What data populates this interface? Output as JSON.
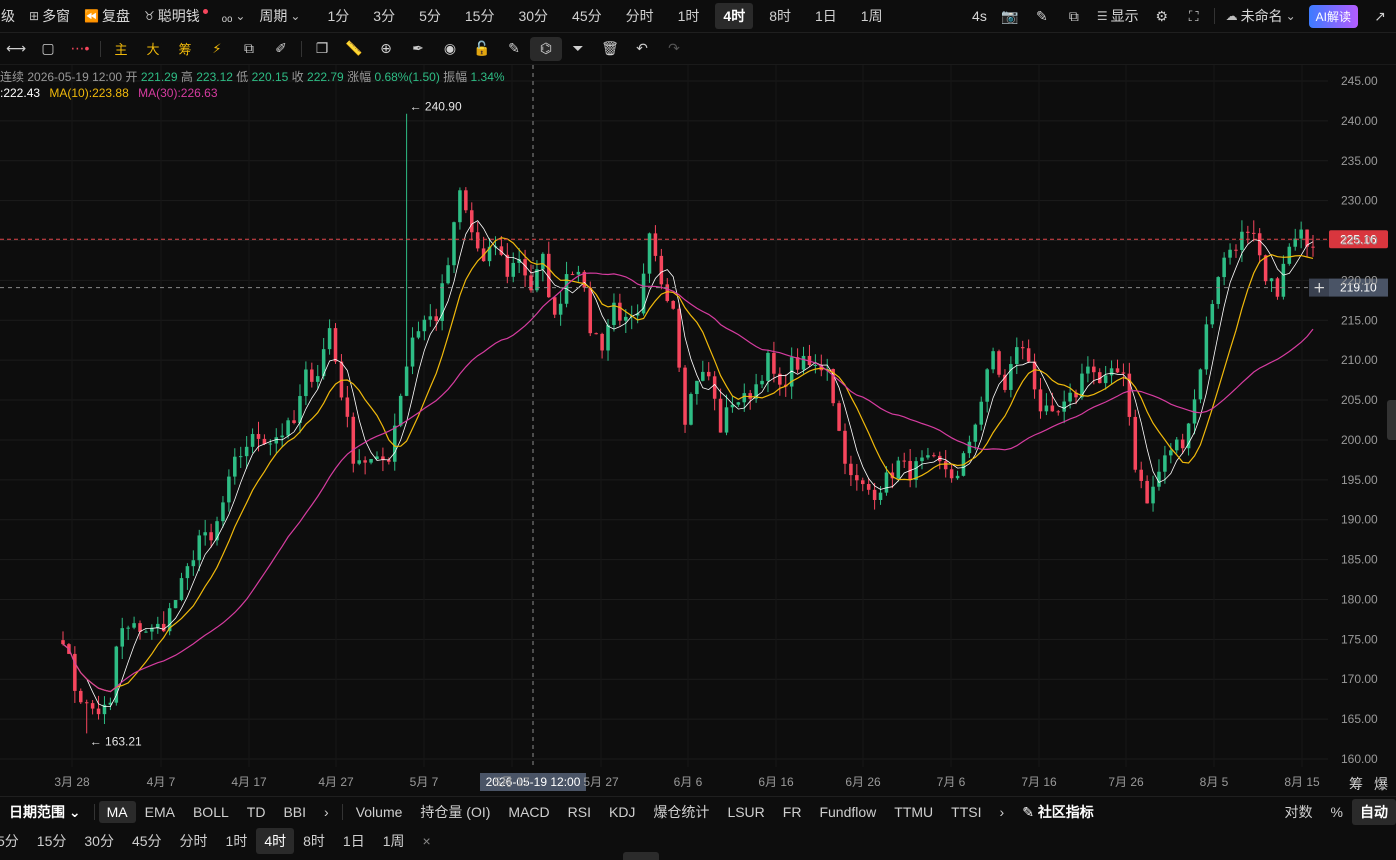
{
  "topbar": {
    "left_items": [
      {
        "label": "级",
        "icon": ""
      },
      {
        "label": "多窗",
        "icon": "grid-icon"
      },
      {
        "label": "复盘",
        "icon": "rewind-icon"
      },
      {
        "label": "聪明钱",
        "icon": "smart-money-icon"
      },
      {
        "label": "ₒₒ",
        "icon": ""
      }
    ],
    "period_label": "周期",
    "timeframes": [
      "1分",
      "3分",
      "5分",
      "15分",
      "30分",
      "45分",
      "分时",
      "1时",
      "4时",
      "8时",
      "1日",
      "1周"
    ],
    "active_timeframe": "4时",
    "right_interval": "4s",
    "display_label": "显示",
    "layout_name": "未命名",
    "ai_label": "AI解读"
  },
  "toolbar": {
    "chart_type_labels": [
      "主",
      "大",
      "筹"
    ]
  },
  "ohlc": {
    "label": "连续",
    "date": "2026-05-19 12:00",
    "open_label": "开",
    "open": "221.29",
    "high_label": "高",
    "high": "223.12",
    "low_label": "低",
    "low": "220.15",
    "close_label": "收",
    "close": "222.79",
    "change_label": "涨幅",
    "change": "0.68%(1.50)",
    "amp_label": "振幅",
    "amp": "1.34%"
  },
  "ma": {
    "ma5": ":222.43",
    "ma10": "MA(10):223.88",
    "ma30": "MA(30):226.63"
  },
  "colors": {
    "up": "#2ebd85",
    "down": "#f6465d",
    "ma5": "#ffffff",
    "ma10": "#f0b90b",
    "ma30": "#d63ca0",
    "price_line": "#e0474c",
    "accent": "#f0b90b"
  },
  "chart_data": {
    "type": "candlestick",
    "y_ticks": [
      "245.00",
      "240.00",
      "235.00",
      "230.00",
      "225.00",
      "220.00",
      "215.00",
      "210.00",
      "205.00",
      "200.00",
      "195.00",
      "190.00",
      "185.00",
      "180.00",
      "175.00",
      "170.00",
      "165.00",
      "160.00"
    ],
    "ylim": [
      157.5,
      247.5
    ],
    "x_ticks": [
      "3月 28",
      "4月 7",
      "4月 17",
      "4月 27",
      "5月 7",
      "5月 17",
      "5月 27",
      "6月 6",
      "6月 16",
      "6月 26",
      "7月 6",
      "7月 16",
      "7月 26",
      "8月 5",
      "8月 15"
    ],
    "crosshair_date": "2026-05-19 12:00",
    "last_price": "225.16",
    "crosshair_price": "219.10",
    "high_marker": "240.90",
    "low_marker": "163.21",
    "anchors": [
      [
        0,
        175.5
      ],
      [
        2,
        169
      ],
      [
        4,
        166.5
      ],
      [
        6,
        166
      ],
      [
        8,
        166.5
      ],
      [
        9,
        174
      ],
      [
        10,
        176
      ],
      [
        13,
        176.5
      ],
      [
        15,
        176
      ],
      [
        17,
        177
      ],
      [
        19,
        180
      ],
      [
        21,
        183.5
      ],
      [
        23,
        188
      ],
      [
        25,
        187
      ],
      [
        27,
        192
      ],
      [
        29,
        197
      ],
      [
        31,
        199.5
      ],
      [
        33,
        200.5
      ],
      [
        35,
        200
      ],
      [
        37,
        201
      ],
      [
        39,
        202
      ],
      [
        41,
        208
      ],
      [
        43,
        208.5
      ],
      [
        45,
        214
      ],
      [
        47,
        206
      ],
      [
        49,
        198
      ],
      [
        51,
        197.5
      ],
      [
        53,
        197
      ],
      [
        55,
        198
      ],
      [
        57,
        206
      ],
      [
        59,
        213
      ],
      [
        61,
        215
      ],
      [
        63,
        215.5
      ],
      [
        65,
        222
      ],
      [
        67,
        231
      ],
      [
        69,
        226
      ],
      [
        71,
        222
      ],
      [
        73,
        224.5
      ],
      [
        75,
        221
      ],
      [
        77,
        223
      ],
      [
        79,
        219
      ],
      [
        81,
        222.5
      ],
      [
        83,
        215
      ],
      [
        85,
        221
      ],
      [
        87,
        222
      ],
      [
        89,
        214
      ],
      [
        91,
        212
      ],
      [
        93,
        217
      ],
      [
        95,
        214.5
      ],
      [
        97,
        215
      ],
      [
        99,
        225
      ],
      [
        101,
        220
      ],
      [
        103,
        217
      ],
      [
        105,
        203
      ],
      [
        107,
        208
      ],
      [
        109,
        208
      ],
      [
        111,
        201.5
      ],
      [
        113,
        205
      ],
      [
        115,
        205
      ],
      [
        117,
        207
      ],
      [
        119,
        210
      ],
      [
        121,
        206
      ],
      [
        123,
        209.5
      ],
      [
        125,
        209.5
      ],
      [
        127,
        209
      ],
      [
        129,
        209.5
      ],
      [
        131,
        201
      ],
      [
        133,
        195
      ],
      [
        135,
        194
      ],
      [
        137,
        193.5
      ],
      [
        139,
        195
      ],
      [
        141,
        197
      ],
      [
        143,
        196
      ],
      [
        145,
        197
      ],
      [
        147,
        197
      ],
      [
        149,
        196.5
      ],
      [
        151,
        195
      ],
      [
        153,
        200
      ],
      [
        155,
        205
      ],
      [
        157,
        211
      ],
      [
        159,
        206
      ],
      [
        161,
        212
      ],
      [
        163,
        210
      ],
      [
        165,
        204
      ],
      [
        167,
        202.5
      ],
      [
        169,
        204
      ],
      [
        171,
        206
      ],
      [
        173,
        210
      ],
      [
        175,
        207
      ],
      [
        177,
        208
      ],
      [
        179,
        209
      ],
      [
        181,
        197
      ],
      [
        183,
        192
      ],
      [
        185,
        196
      ],
      [
        187,
        199
      ],
      [
        189,
        200
      ],
      [
        191,
        205
      ],
      [
        193,
        214
      ],
      [
        195,
        221
      ],
      [
        197,
        224
      ],
      [
        199,
        225.5
      ],
      [
        201,
        225
      ],
      [
        203,
        219.5
      ],
      [
        205,
        219
      ],
      [
        207,
        224
      ],
      [
        209,
        225.5
      ],
      [
        211,
        225
      ]
    ],
    "n_candles": 212
  },
  "bottom": {
    "range_label": "日期范围",
    "main_indicators": [
      "MA",
      "EMA",
      "BOLL",
      "TD",
      "BBI"
    ],
    "active_main": "MA",
    "sub_indicators": [
      "Volume",
      "持仓量 (OI)",
      "MACD",
      "RSI",
      "KDJ",
      "爆仓统计",
      "LSUR",
      "FR",
      "Fundflow",
      "TTMU",
      "TTSI"
    ],
    "community_label": "社区指标",
    "log_label": "对数",
    "percent_label": "%",
    "auto_label": "自动",
    "quick_timeframes": [
      "5分",
      "15分",
      "30分",
      "45分",
      "分时",
      "1时",
      "4时",
      "8时",
      "1日",
      "1周"
    ],
    "active_quick": "4时",
    "extra_labels": [
      "筹",
      "爆"
    ]
  }
}
